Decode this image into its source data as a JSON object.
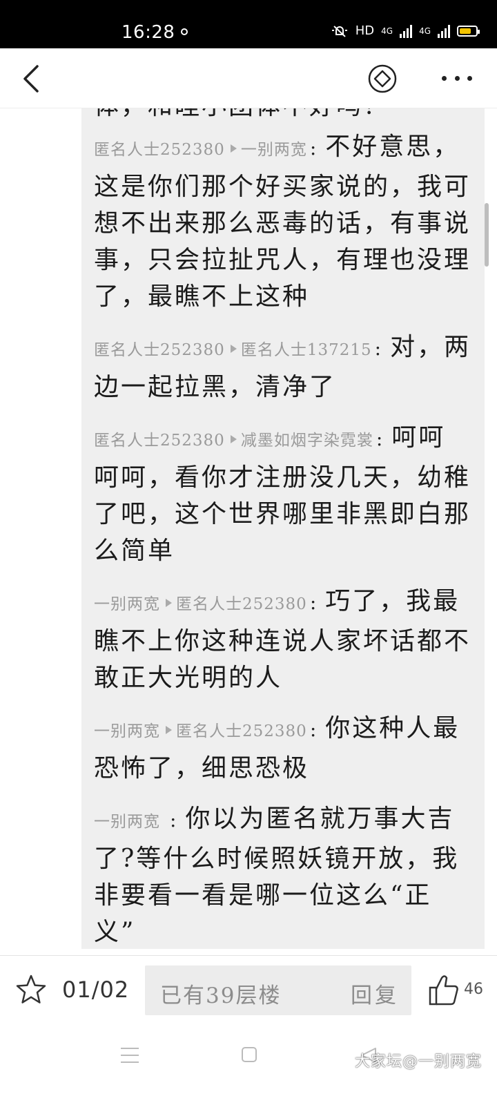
{
  "status_bar": {
    "time": "16:28",
    "network_label": "HD",
    "sim1_label": "4G",
    "sim2_label": "4G"
  },
  "header": {
    "back_icon": "chevron-left-icon",
    "action_icon": "diamond-icon",
    "more_icon": "more-horizontal-icon"
  },
  "comments": {
    "partial_top": "体，和睦小团体不好吗?",
    "items": [
      {
        "author": "匿名人士252380",
        "target": "一别两宽",
        "text": "不好意思，这是你们那个好买家说的，我可想不出来那么恶毒的话，有事说事，只会拉扯咒人，有理也没理了，最瞧不上这种"
      },
      {
        "author": "匿名人士252380",
        "target": "匿名人士137215",
        "text": "对，两边一起拉黑，清净了"
      },
      {
        "author": "匿名人士252380",
        "target": "减墨如烟字染霓裳",
        "text": "呵呵呵呵，看你才注册没几天，幼稚了吧，这个世界哪里非黑即白那么简单"
      },
      {
        "author": "一别两宽",
        "target": "匿名人士252380",
        "text": "巧了，我最瞧不上你这种连说人家坏话都不敢正大光明的人"
      },
      {
        "author": "一别两宽",
        "target": "匿名人士252380",
        "text": "你这种人最恐怖了，细思恐极"
      },
      {
        "author": "一别两宽",
        "target": "",
        "text": "你以为匿名就万事大吉了?等什么时候照妖镜开放，我非要看一看是哪一位这么“正义”"
      }
    ]
  },
  "bottom_bar": {
    "star_icon": "star-outline-icon",
    "page_indicator": "01/02",
    "reply_placeholder": "已有39层楼",
    "reply_button": "回复",
    "like_icon": "thumbs-up-icon",
    "like_count": "46"
  },
  "system_nav": {
    "menu_icon": "menu-icon",
    "home_icon": "home-square-icon",
    "back_icon": "back-triangle-icon"
  },
  "watermark": "大家坛@一别两宽",
  "colors": {
    "panel_bg": "#efefef",
    "meta_text": "#9a9a9a",
    "body_text": "#1b1b1b",
    "battery": "#f2c300"
  }
}
